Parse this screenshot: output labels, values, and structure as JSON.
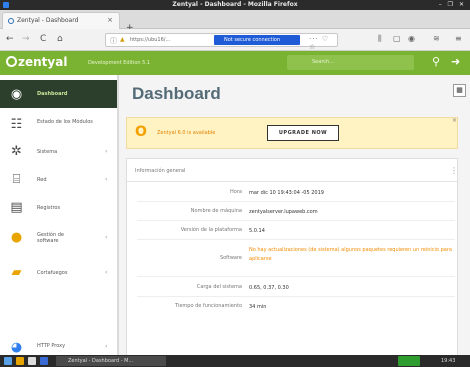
{
  "window": {
    "title": "Zentyal - Dashboard - Mozilla Firefox",
    "controls": "– ❐ ✕"
  },
  "tab": {
    "title": "Zentyal - Dashboard",
    "close": "×"
  },
  "newtab": "+",
  "nav": {
    "back": "←",
    "forward": "→",
    "reload": "C",
    "home": "⌂",
    "url": "https://ubu16/...",
    "cert_warning": "Not secure connection",
    "more": "··· ♡ ☆"
  },
  "toolbar_icons": [
    "⫼",
    "▢",
    "◉",
    "≋",
    "≡"
  ],
  "zentyal": {
    "logo": "zentyal",
    "edition": "Development Edition 5.1",
    "search_placeholder": "Search...",
    "search_icon": "search-icon",
    "logout_icon": "logout-icon",
    "accent": "#7ab332"
  },
  "sidebar": {
    "items": [
      {
        "label": "Dashboard",
        "icon": "dashboard-icon",
        "arrow": ""
      },
      {
        "label": "Estado de los Módulos",
        "icon": "modules-icon",
        "arrow": ""
      },
      {
        "label": "Sistema",
        "icon": "gear-icon",
        "arrow": "‹"
      },
      {
        "label": "Red",
        "icon": "network-icon",
        "arrow": "‹"
      },
      {
        "label": "Registros",
        "icon": "logs-icon",
        "arrow": ""
      },
      {
        "label": "Gestión de software",
        "icon": "package-icon",
        "arrow": "‹"
      },
      {
        "label": "Cortafuegos",
        "icon": "firewall-icon",
        "arrow": "‹"
      },
      {
        "label": "HTTP Proxy",
        "icon": "proxy-icon",
        "arrow": "‹"
      }
    ]
  },
  "main": {
    "title": "Dashboard",
    "grid_icon": "grid-icon",
    "banner": {
      "message": "Zentyal 6.0 is available",
      "button": "UPGRADE NOW",
      "close": "×"
    },
    "panel": {
      "title": "Información general",
      "menu": "⋮",
      "rows": [
        {
          "key": "Hora",
          "value": "mar dic 10 19:43:04 -05 2019",
          "orange": false
        },
        {
          "key": "Nombre de máquina",
          "value": "zentyalserver.lupaweb.com",
          "orange": false
        },
        {
          "key": "Versión de la plataforma",
          "value": "5.0.14",
          "orange": false
        },
        {
          "key": "Software",
          "value": "No hay actualizaciones (de sistema) algunos paquetes requieren un reinicio para aplicarse",
          "orange": true
        },
        {
          "key": "Carga del sistema",
          "value": "0.65, 0.37, 0.30",
          "orange": false
        },
        {
          "key": "Tiempo de funcionamiento",
          "value": "34 min",
          "orange": false
        }
      ]
    }
  },
  "taskbar": {
    "items": [
      {
        "label": "Zentyal - Dashboard - M..."
      }
    ],
    "tray": "19:43"
  }
}
